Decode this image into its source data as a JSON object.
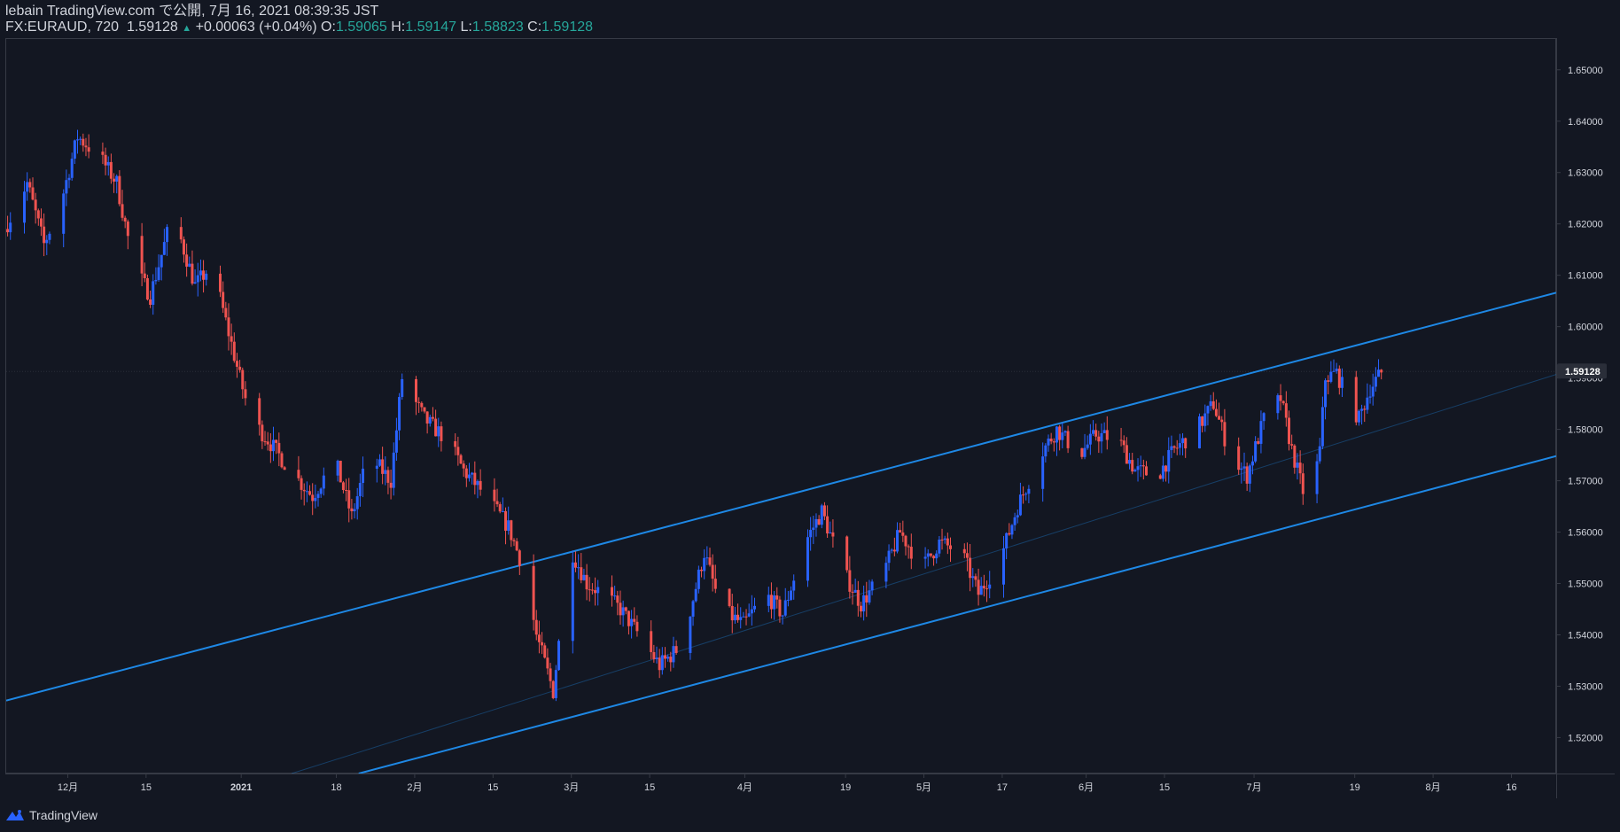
{
  "header": {
    "line1": "lebain TradingView.com で公開, 7月 16, 2021 08:39:35 JST",
    "symbol": "FX:EURAUD, 720",
    "last": "1.59128",
    "change_arrow": "▲",
    "change": "+0.00063 (+0.04%)",
    "o_label": "O:",
    "o_value": "1.59065",
    "h_label": "H:",
    "h_value": "1.59147",
    "l_label": "L:",
    "l_value": "1.58823",
    "c_label": "C:",
    "c_value": "1.59128"
  },
  "footer": {
    "brand": "TradingView",
    "logo_icon": "tradingview-logo-icon"
  },
  "colors": {
    "background": "#131722",
    "up": "#2962ff",
    "down": "#ef5350",
    "channel": "#1e88e5",
    "text": "#d1d4dc",
    "green": "#26a69a"
  },
  "chart_data": {
    "type": "candlestick",
    "symbol": "FX:EURAUD",
    "interval": "720",
    "ylim": [
      1.513,
      1.656
    ],
    "y_ticks": [
      1.52,
      1.53,
      1.54,
      1.55,
      1.56,
      1.57,
      1.58,
      1.59,
      1.6,
      1.61,
      1.62,
      1.63,
      1.64,
      1.65
    ],
    "y_tick_labels": [
      "1.52000",
      "1.53000",
      "1.54000",
      "1.55000",
      "1.56000",
      "1.57000",
      "1.58000",
      "1.59000",
      "1.60000",
      "1.61000",
      "1.62000",
      "1.63000",
      "1.64000",
      "1.65000"
    ],
    "last_price_label": "1.59128",
    "last_price": 1.59128,
    "x_range": [
      "2020-11-20",
      "2021-08-24"
    ],
    "x_ticks": [
      {
        "date": "2020-12-01",
        "label": "12月",
        "bold": false
      },
      {
        "date": "2020-12-15",
        "label": "15",
        "bold": false
      },
      {
        "date": "2021-01-01",
        "label": "2021",
        "bold": true
      },
      {
        "date": "2021-01-18",
        "label": "18",
        "bold": false
      },
      {
        "date": "2021-02-01",
        "label": "2月",
        "bold": false
      },
      {
        "date": "2021-02-15",
        "label": "15",
        "bold": false
      },
      {
        "date": "2021-03-01",
        "label": "3月",
        "bold": false
      },
      {
        "date": "2021-03-15",
        "label": "15",
        "bold": false
      },
      {
        "date": "2021-04-01",
        "label": "4月",
        "bold": false
      },
      {
        "date": "2021-04-19",
        "label": "19",
        "bold": false
      },
      {
        "date": "2021-05-03",
        "label": "5月",
        "bold": false
      },
      {
        "date": "2021-05-17",
        "label": "17",
        "bold": false
      },
      {
        "date": "2021-06-01",
        "label": "6月",
        "bold": false
      },
      {
        "date": "2021-06-15",
        "label": "15",
        "bold": false
      },
      {
        "date": "2021-07-01",
        "label": "7月",
        "bold": false
      },
      {
        "date": "2021-07-19",
        "label": "19",
        "bold": false
      },
      {
        "date": "2021-08-02",
        "label": "8月",
        "bold": false
      },
      {
        "date": "2021-08-16",
        "label": "16",
        "bold": false
      }
    ],
    "channel": {
      "upper": {
        "start": [
          "2020-11-20",
          1.5272
        ],
        "end": [
          "2021-08-24",
          1.6066
        ]
      },
      "lower": {
        "start": [
          "2021-01-22",
          1.513
        ],
        "end": [
          "2021-08-24",
          1.5748
        ]
      },
      "mid": {
        "start": [
          "2021-01-10",
          1.513
        ],
        "end": [
          "2021-08-24",
          1.5907
        ]
      }
    },
    "price_path": [
      [
        "2020-11-20",
        1.619
      ],
      [
        "2020-11-24",
        1.628
      ],
      [
        "2020-11-27",
        1.616
      ],
      [
        "2020-11-30",
        1.624
      ],
      [
        "2020-12-03",
        1.637
      ],
      [
        "2020-12-07",
        1.633
      ],
      [
        "2020-12-10",
        1.628
      ],
      [
        "2020-12-13",
        1.612
      ],
      [
        "2020-12-16",
        1.606
      ],
      [
        "2020-12-20",
        1.622
      ],
      [
        "2020-12-24",
        1.608
      ],
      [
        "2020-12-27",
        1.612
      ],
      [
        "2021-01-01",
        1.59
      ],
      [
        "2021-01-03",
        1.582
      ],
      [
        "2021-01-06",
        1.578
      ],
      [
        "2021-01-10",
        1.572
      ],
      [
        "2021-01-14",
        1.567
      ],
      [
        "2021-01-18",
        1.574
      ],
      [
        "2021-01-21",
        1.563
      ],
      [
        "2021-01-24",
        1.575
      ],
      [
        "2021-01-28",
        1.57
      ],
      [
        "2021-01-30",
        1.59
      ],
      [
        "2021-02-03",
        1.582
      ],
      [
        "2021-02-07",
        1.578
      ],
      [
        "2021-02-10",
        1.572
      ],
      [
        "2021-02-14",
        1.567
      ],
      [
        "2021-02-18",
        1.561
      ],
      [
        "2021-02-21",
        1.552
      ],
      [
        "2021-02-23",
        1.54
      ],
      [
        "2021-02-26",
        1.529
      ],
      [
        "2021-03-01",
        1.557
      ],
      [
        "2021-03-04",
        1.55
      ],
      [
        "2021-03-07",
        1.548
      ],
      [
        "2021-03-10",
        1.545
      ],
      [
        "2021-03-14",
        1.539
      ],
      [
        "2021-03-17",
        1.534
      ],
      [
        "2021-03-21",
        1.538
      ],
      [
        "2021-03-25",
        1.556
      ],
      [
        "2021-03-28",
        1.545
      ],
      [
        "2021-04-01",
        1.542
      ],
      [
        "2021-04-05",
        1.548
      ],
      [
        "2021-04-08",
        1.544
      ],
      [
        "2021-04-12",
        1.558
      ],
      [
        "2021-04-15",
        1.564
      ],
      [
        "2021-04-19",
        1.552
      ],
      [
        "2021-04-22",
        1.546
      ],
      [
        "2021-04-26",
        1.552
      ],
      [
        "2021-04-29",
        1.56
      ],
      [
        "2021-05-03",
        1.553
      ],
      [
        "2021-05-06",
        1.558
      ],
      [
        "2021-05-10",
        1.556
      ],
      [
        "2021-05-13",
        1.548
      ],
      [
        "2021-05-17",
        1.555
      ],
      [
        "2021-05-20",
        1.565
      ],
      [
        "2021-05-24",
        1.575
      ],
      [
        "2021-05-27",
        1.58
      ],
      [
        "2021-05-31",
        1.575
      ],
      [
        "2021-06-03",
        1.579
      ],
      [
        "2021-06-07",
        1.578
      ],
      [
        "2021-06-10",
        1.572
      ],
      [
        "2021-06-14",
        1.571
      ],
      [
        "2021-06-17",
        1.576
      ],
      [
        "2021-06-21",
        1.58
      ],
      [
        "2021-06-24",
        1.585
      ],
      [
        "2021-06-27",
        1.575
      ],
      [
        "2021-06-30",
        1.571
      ],
      [
        "2021-07-03",
        1.582
      ],
      [
        "2021-07-06",
        1.586
      ],
      [
        "2021-07-08",
        1.576
      ],
      [
        "2021-07-11",
        1.564
      ],
      [
        "2021-07-13",
        1.576
      ],
      [
        "2021-07-14",
        1.59
      ],
      [
        "2021-07-16",
        1.591
      ],
      [
        "2021-07-18",
        1.586
      ],
      [
        "2021-07-20",
        1.582
      ],
      [
        "2021-07-22",
        1.588
      ],
      [
        "2021-07-24",
        1.591
      ]
    ]
  }
}
